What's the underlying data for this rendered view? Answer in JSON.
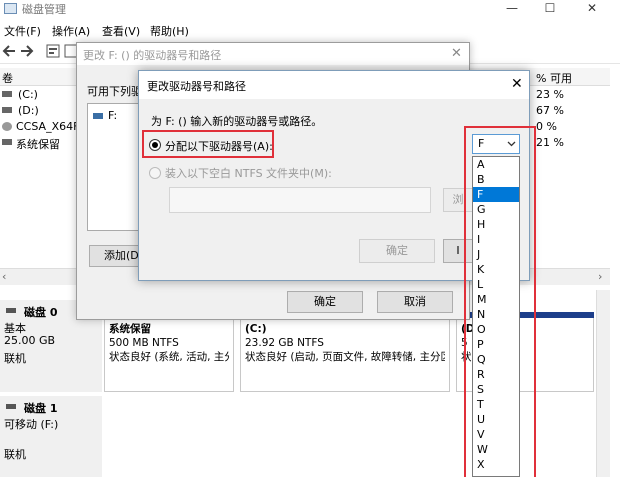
{
  "window": {
    "title": "磁盘管理",
    "controls": [
      "—",
      "☐",
      "✕"
    ]
  },
  "menu": [
    "文件(F)",
    "操作(A)",
    "查看(V)",
    "帮助(H)"
  ],
  "volume_list": {
    "col_volume": "卷",
    "col_pct_free": "% 可用",
    "rows": [
      {
        "name": "(C:)",
        "pct": "23 %"
      },
      {
        "name": "(D:)",
        "pct": "67 %"
      },
      {
        "name": "CCSA_X64FR",
        "pct": "0 %"
      },
      {
        "name": "系统保留",
        "pct": "21 %"
      }
    ]
  },
  "disks": [
    {
      "name": "磁盘 0",
      "type": "基本",
      "size": "25.00 GB",
      "status": "联机"
    },
    {
      "name": "磁盘 1",
      "type": "可移动 (F:)",
      "status": "联机"
    }
  ],
  "partitions": [
    {
      "name": "系统保留",
      "size": "500 MB NTFS",
      "status": "状态良好 (系统, 活动, 主分"
    },
    {
      "name": "(C:)",
      "size": "23.92 GB NTFS",
      "status": "状态良好 (启动, 页面文件, 故障转储, 主分区"
    },
    {
      "name": "(D:)",
      "size": "5 NTFS",
      "status": "状 区)"
    }
  ],
  "dialog_back": {
    "title": "更改 F: () 的驱动器号和路径",
    "allow_label": "可用下列驱",
    "list_item": "F:",
    "add_button": "添加(D",
    "ok_button": "确定",
    "cancel_button": "取消"
  },
  "dialog_front": {
    "title": "更改驱动器号和路径",
    "instruction": "为 F: () 输入新的驱动器号或路径。",
    "assign_label": "分配以下驱动器号(A):",
    "mount_label": "装入以下空白 NTFS 文件夹中(M):",
    "browse_button": "浏",
    "ok_button": "确定",
    "cancel_button": "I"
  },
  "drive_letter": {
    "selected": "F",
    "options": [
      "A",
      "B",
      "F",
      "G",
      "H",
      "I",
      "J",
      "K",
      "L",
      "M",
      "N",
      "O",
      "P",
      "Q",
      "R",
      "S",
      "T",
      "U",
      "V",
      "W",
      "X"
    ]
  },
  "colors": {
    "highlight": "#0078d7",
    "annotation": "#e0303a",
    "disk_bar": "#1d3e8a"
  }
}
